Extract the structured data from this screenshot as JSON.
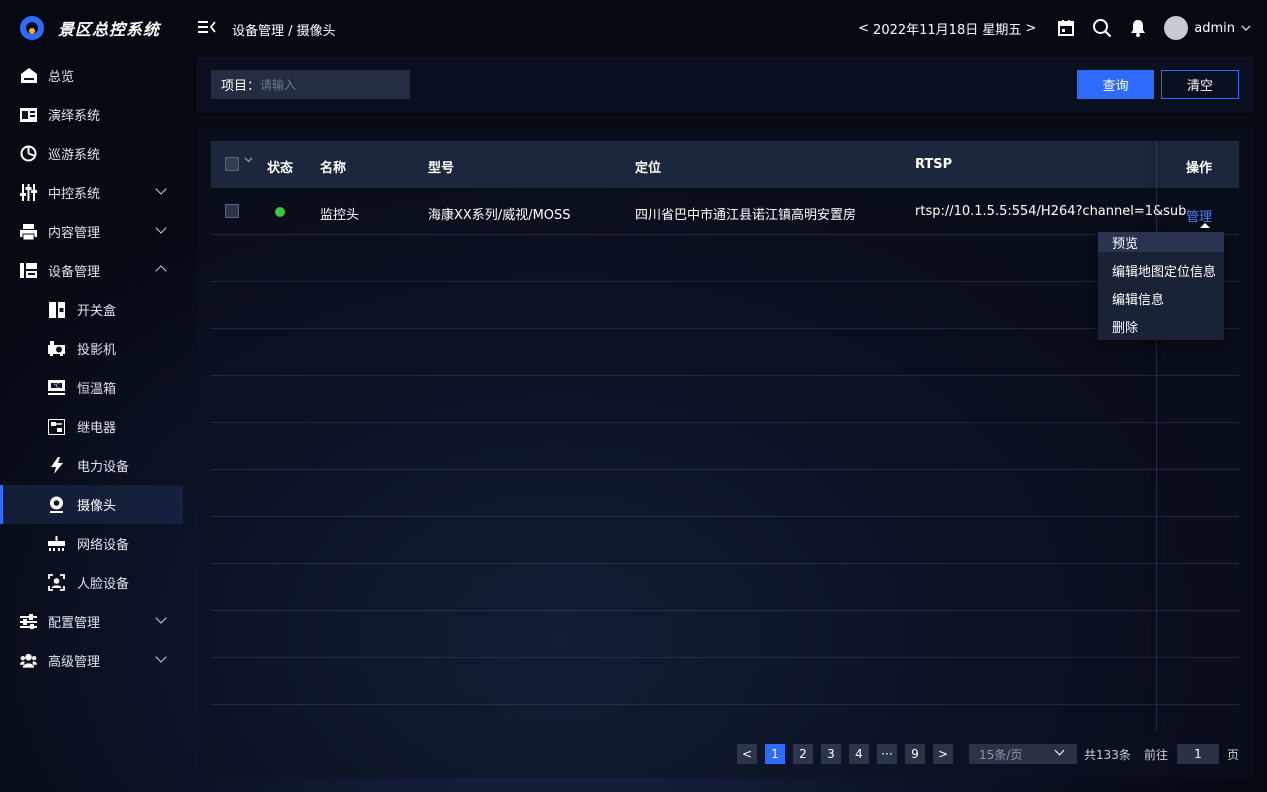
{
  "app": {
    "title": "景区总控系统"
  },
  "header": {
    "breadcrumb": "设备管理 / 摄像头",
    "date_prev": "<",
    "date": "2022年11月18日 星期五",
    "date_next": ">",
    "user": "admin"
  },
  "sidebar": {
    "items": [
      {
        "label": "总览",
        "icon": "home-icon"
      },
      {
        "label": "演绎系统",
        "icon": "id-card-icon"
      },
      {
        "label": "巡游系统",
        "icon": "pie-chart-icon"
      },
      {
        "label": "中控系统",
        "icon": "sliders-icon",
        "expandable": true
      },
      {
        "label": "内容管理",
        "icon": "printer-icon",
        "expandable": true
      },
      {
        "label": "设备管理",
        "icon": "device-icon",
        "expanded": true
      },
      {
        "label": "配置管理",
        "icon": "settings-icon",
        "expandable": true
      },
      {
        "label": "高级管理",
        "icon": "users-icon",
        "expandable": true
      }
    ],
    "sub_items": [
      {
        "label": "开关盒",
        "icon": "switch-box-icon"
      },
      {
        "label": "投影机",
        "icon": "projector-icon"
      },
      {
        "label": "恒温箱",
        "icon": "thermostat-icon"
      },
      {
        "label": "继电器",
        "icon": "relay-icon"
      },
      {
        "label": "电力设备",
        "icon": "lightning-icon"
      },
      {
        "label": "摄像头",
        "icon": "camera-icon",
        "active": true
      },
      {
        "label": "网络设备",
        "icon": "network-icon"
      },
      {
        "label": "人脸设备",
        "icon": "face-icon"
      }
    ]
  },
  "filter": {
    "label": "项目：",
    "placeholder": "请输入",
    "query_label": "查询",
    "clear_label": "清空"
  },
  "table": {
    "columns": [
      "状态",
      "名称",
      "型号",
      "定位",
      "RTSP",
      "操作"
    ],
    "rows": [
      {
        "status": "online",
        "name": "监控头",
        "model": "海康XX系列/威视/MOSS",
        "location": "四川省巴中市通江县诺江镇高明安置房",
        "rtsp": "rtsp://10.1.5.5:554/H264?channel=1&sub",
        "action": "管理"
      }
    ],
    "actions_menu": [
      "预览",
      "编辑地图定位信息",
      "编辑信息",
      "删除"
    ]
  },
  "pagination": {
    "prev": "<",
    "pages": [
      "1",
      "2",
      "3",
      "4",
      "···",
      "9"
    ],
    "current": "1",
    "next": ">",
    "page_size": "15条/页",
    "total": "共133条",
    "goto_label": "前往",
    "goto_value": "1",
    "page_unit": "页"
  },
  "colors": {
    "accent": "#2f6bff",
    "status_online": "#3ec53e",
    "link": "#4b7bff"
  }
}
